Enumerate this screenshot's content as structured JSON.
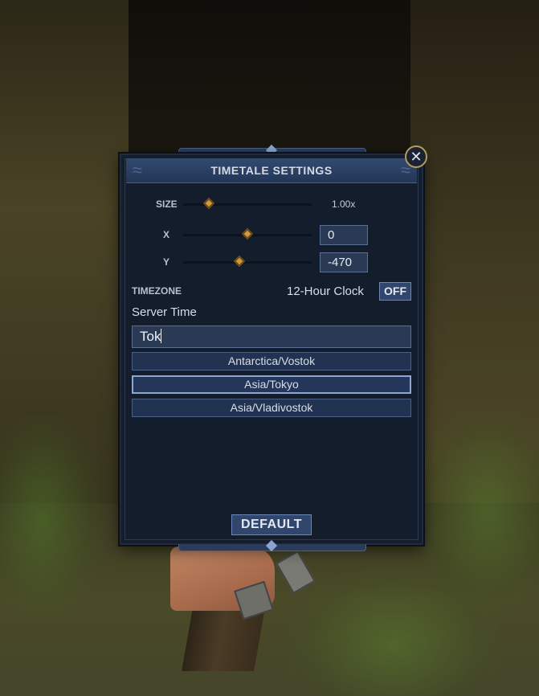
{
  "window": {
    "title": "TIMETALE SETTINGS"
  },
  "size": {
    "label": "SIZE",
    "value": "1.00x",
    "slider_fraction": 0.2
  },
  "x": {
    "label": "X",
    "value": "0",
    "slider_fraction": 0.5
  },
  "y": {
    "label": "Y",
    "value": "-470",
    "slider_fraction": 0.44
  },
  "timezone": {
    "label": "TIMEZONE",
    "clock_label": "12-Hour Clock",
    "clock_toggle": "OFF",
    "current": "Server Time",
    "search_value": "Tok",
    "options": [
      "Antarctica/Vostok",
      "Asia/Tokyo",
      "Asia/Vladivostok"
    ],
    "highlighted": "Asia/Tokyo"
  },
  "buttons": {
    "default_label": "DEFAULT"
  },
  "icons": {
    "close": "close-icon",
    "slider_knob": "diamond-icon"
  },
  "colors": {
    "panel_bg": "#141d2c",
    "title_bar": "#2a3f62",
    "knob": "#d19a3a",
    "close_ring": "#b89a5a"
  }
}
